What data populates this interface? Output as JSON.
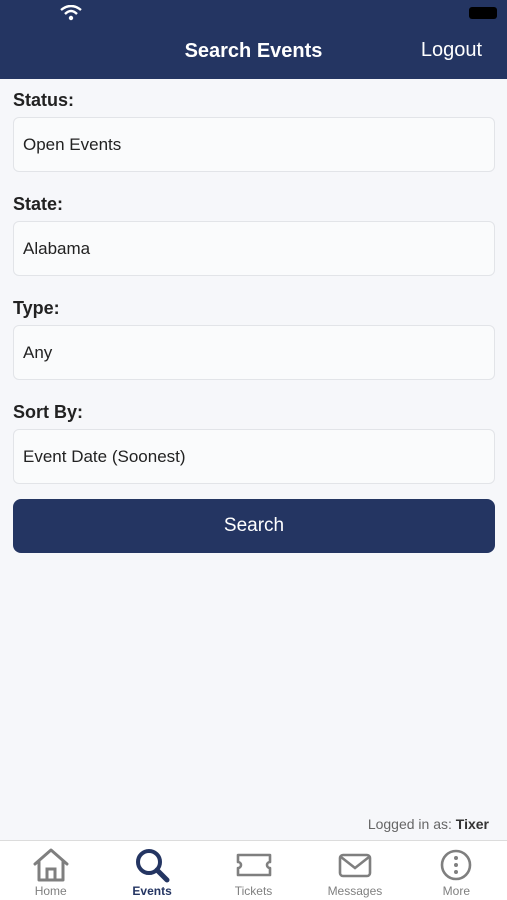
{
  "header": {
    "title": "Search Events",
    "logout_label": "Logout"
  },
  "form": {
    "status": {
      "label": "Status:",
      "value": "Open Events"
    },
    "state": {
      "label": "State:",
      "value": "Alabama"
    },
    "type": {
      "label": "Type:",
      "value": "Any"
    },
    "sort": {
      "label": "Sort By:",
      "value": "Event Date (Soonest)"
    },
    "search_label": "Search"
  },
  "footer": {
    "logged_prefix": "Logged in as:",
    "user": "Tixer"
  },
  "tabs": [
    {
      "label": "Home",
      "icon": "home-icon"
    },
    {
      "label": "Events",
      "icon": "search-icon",
      "active": true
    },
    {
      "label": "Tickets",
      "icon": "ticket-icon"
    },
    {
      "label": "Messages",
      "icon": "envelope-icon"
    },
    {
      "label": "More",
      "icon": "more-icon"
    }
  ],
  "colors": {
    "brand": "#243562",
    "background": "#f6f7fa"
  }
}
